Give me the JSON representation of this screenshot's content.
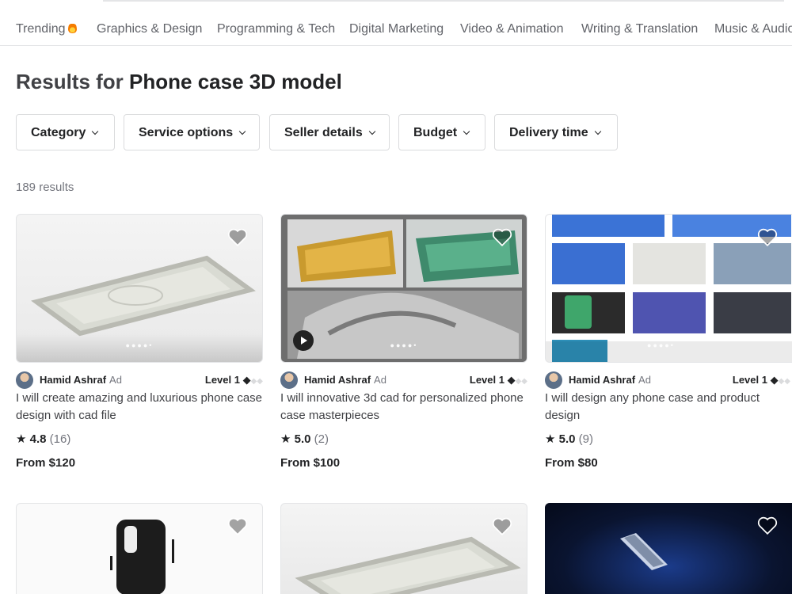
{
  "category_nav": [
    "Trending",
    "Graphics & Design",
    "Programming & Tech",
    "Digital Marketing",
    "Video & Animation",
    "Writing & Translation",
    "Music & Audio"
  ],
  "results": {
    "prefix": "Results for",
    "query": "Phone case 3D model",
    "count": "189 results"
  },
  "filters": [
    "Category",
    "Service options",
    "Seller details",
    "Budget",
    "Delivery time"
  ],
  "gigs": [
    {
      "seller": "Hamid Ashraf",
      "ad": "Ad",
      "level": "Level 1",
      "title": "I will create amazing and luxurious phone case design with cad file",
      "rating": "4.8",
      "reviews": "(16)",
      "price": "From $120"
    },
    {
      "seller": "Hamid Ashraf",
      "ad": "Ad",
      "level": "Level 1",
      "title": "I will innovative 3d cad for personalized phone case masterpieces",
      "rating": "5.0",
      "reviews": "(2)",
      "price": "From $100"
    },
    {
      "seller": "Hamid Ashraf",
      "ad": "Ad",
      "level": "Level 1",
      "title": "I will design any phone case and product design",
      "rating": "5.0",
      "reviews": "(9)",
      "price": "From $80"
    }
  ],
  "icons": {
    "trending": "flame-icon",
    "heart": "heart-icon",
    "star": "star-icon",
    "level": "diamond-icon",
    "filter": "chevron-down-icon",
    "video": "play-icon"
  },
  "colors": {
    "text": "#404145",
    "muted": "#74767e",
    "border": "#dadbdd"
  }
}
